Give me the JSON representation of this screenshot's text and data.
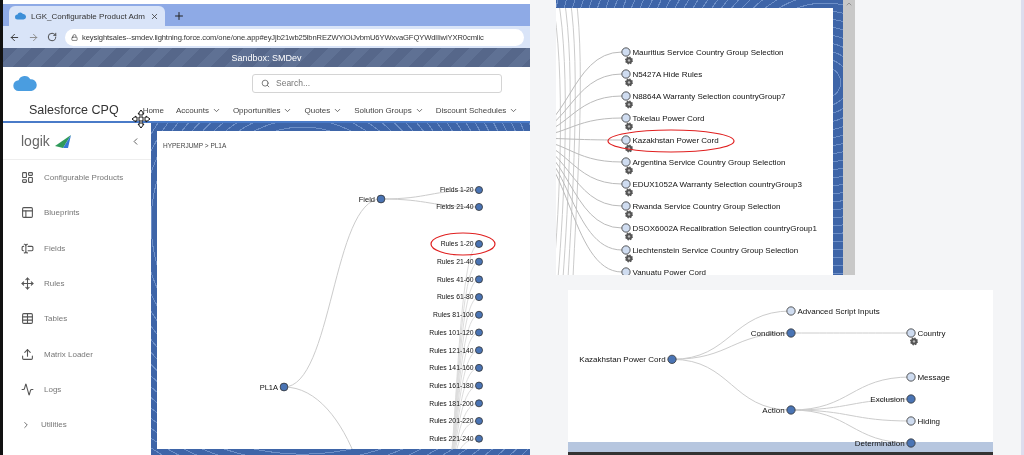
{
  "browser": {
    "tab": {
      "title": "LGK_Configurable Product Adm"
    },
    "url": "keysightsales--smdev.lightning.force.com/one/one.app#eyJjb21wb25lbnREZWYiOiJvbmU6YWxvaGFQYWdlIiwiYXR0cmlic"
  },
  "sandbox_banner": "Sandbox: SMDev",
  "search": {
    "placeholder": "Search..."
  },
  "app_name": "Salesforce CPQ",
  "nav_items": [
    {
      "label": "Home",
      "dropdown": false
    },
    {
      "label": "Accounts",
      "dropdown": true
    },
    {
      "label": "Opportunities",
      "dropdown": true
    },
    {
      "label": "Quotes",
      "dropdown": true
    },
    {
      "label": "Solution Groups",
      "dropdown": true
    },
    {
      "label": "Discount Schedules",
      "dropdown": true
    }
  ],
  "sidebar": {
    "logo": "logik",
    "items": [
      {
        "label": "Configurable Products",
        "kind": "link"
      },
      {
        "label": "Blueprints",
        "kind": "link"
      },
      {
        "label": "Fields",
        "kind": "link"
      },
      {
        "label": "Rules",
        "kind": "link"
      },
      {
        "label": "Tables",
        "kind": "link"
      },
      {
        "label": "Matrix Loader",
        "kind": "link"
      },
      {
        "label": "Logs",
        "kind": "link"
      },
      {
        "label": "Utilities",
        "kind": "group"
      }
    ]
  },
  "breadcrumb": "HYPERJUMP > PL1A",
  "canvas_tree": {
    "label": "PL1A",
    "has_children": true,
    "highlighted": false,
    "children": [
      {
        "label": "Field",
        "has_children": true,
        "highlighted": false,
        "children": [
          {
            "label": "Fields 1-20",
            "has_children": true,
            "highlighted": false
          },
          {
            "label": "Fields 21-40",
            "has_children": true,
            "highlighted": false
          }
        ]
      }
    ]
  },
  "rule_nodes": [
    {
      "label": "Rules 1-20",
      "has_children": true,
      "highlighted": true
    },
    {
      "label": "Rules 21-40",
      "has_children": true,
      "highlighted": false
    },
    {
      "label": "Rules 41-60",
      "has_children": true,
      "highlighted": false
    },
    {
      "label": "Rules 61-80",
      "has_children": true,
      "highlighted": false
    },
    {
      "label": "Rules 81-100",
      "has_children": true,
      "highlighted": false
    },
    {
      "label": "Rules 101-120",
      "has_children": true,
      "highlighted": false
    },
    {
      "label": "Rules 121-140",
      "has_children": true,
      "highlighted": false
    },
    {
      "label": "Rules 141-160",
      "has_children": true,
      "highlighted": false
    },
    {
      "label": "Rules 161-180",
      "has_children": true,
      "highlighted": false
    },
    {
      "label": "Rules 181-200",
      "has_children": true,
      "highlighted": false
    },
    {
      "label": "Rules 201-220",
      "has_children": true,
      "highlighted": false
    },
    {
      "label": "Rules 221-240",
      "has_children": true,
      "highlighted": false
    }
  ],
  "rule_list": [
    {
      "label": "Mauritius Service Country Group Selection",
      "has_children": false,
      "gear": true,
      "highlighted": false
    },
    {
      "label": "N5427A Hide Rules",
      "has_children": false,
      "gear": true,
      "highlighted": false
    },
    {
      "label": "N8864A Warranty Selection countryGroup7",
      "has_children": false,
      "gear": true,
      "highlighted": false
    },
    {
      "label": "Tokelau Power Cord",
      "has_children": false,
      "gear": true,
      "highlighted": false
    },
    {
      "label": "Kazakhstan Power Cord",
      "has_children": false,
      "gear": true,
      "highlighted": true
    },
    {
      "label": "Argentina Service Country Group Selection",
      "has_children": false,
      "gear": true,
      "highlighted": false
    },
    {
      "label": "EDUX1052A Warranty Selection countryGroup3",
      "has_children": false,
      "gear": true,
      "highlighted": false
    },
    {
      "label": "Rwanda Service Country Group Selection",
      "has_children": false,
      "gear": true,
      "highlighted": false
    },
    {
      "label": "DSOX6002A Recalibration Selection countryGroup1",
      "has_children": false,
      "gear": true,
      "highlighted": false
    },
    {
      "label": "Liechtenstein Service Country Group Selection",
      "has_children": false,
      "gear": true,
      "highlighted": false
    },
    {
      "label": "Vanuatu Power Cord",
      "has_children": false,
      "gear": false,
      "highlighted": false
    }
  ],
  "rule_tree": {
    "label": "Kazakhstan Power Cord",
    "has_children": true,
    "gear": false,
    "children": [
      {
        "label": "Advanced Script Inputs",
        "has_children": false,
        "gear": false
      },
      {
        "label": "Condition",
        "has_children": true,
        "gear": false,
        "children": [
          {
            "label": "Country",
            "has_children": false,
            "gear": true
          }
        ]
      },
      {
        "label": "Action",
        "has_children": true,
        "gear": false,
        "children": [
          {
            "label": "Message",
            "has_children": false,
            "gear": false
          },
          {
            "label": "Exclusion",
            "has_children": true,
            "gear": false
          },
          {
            "label": "Hiding",
            "has_children": false,
            "gear": false
          },
          {
            "label": "Determination",
            "has_children": true,
            "gear": false
          }
        ]
      }
    ]
  }
}
